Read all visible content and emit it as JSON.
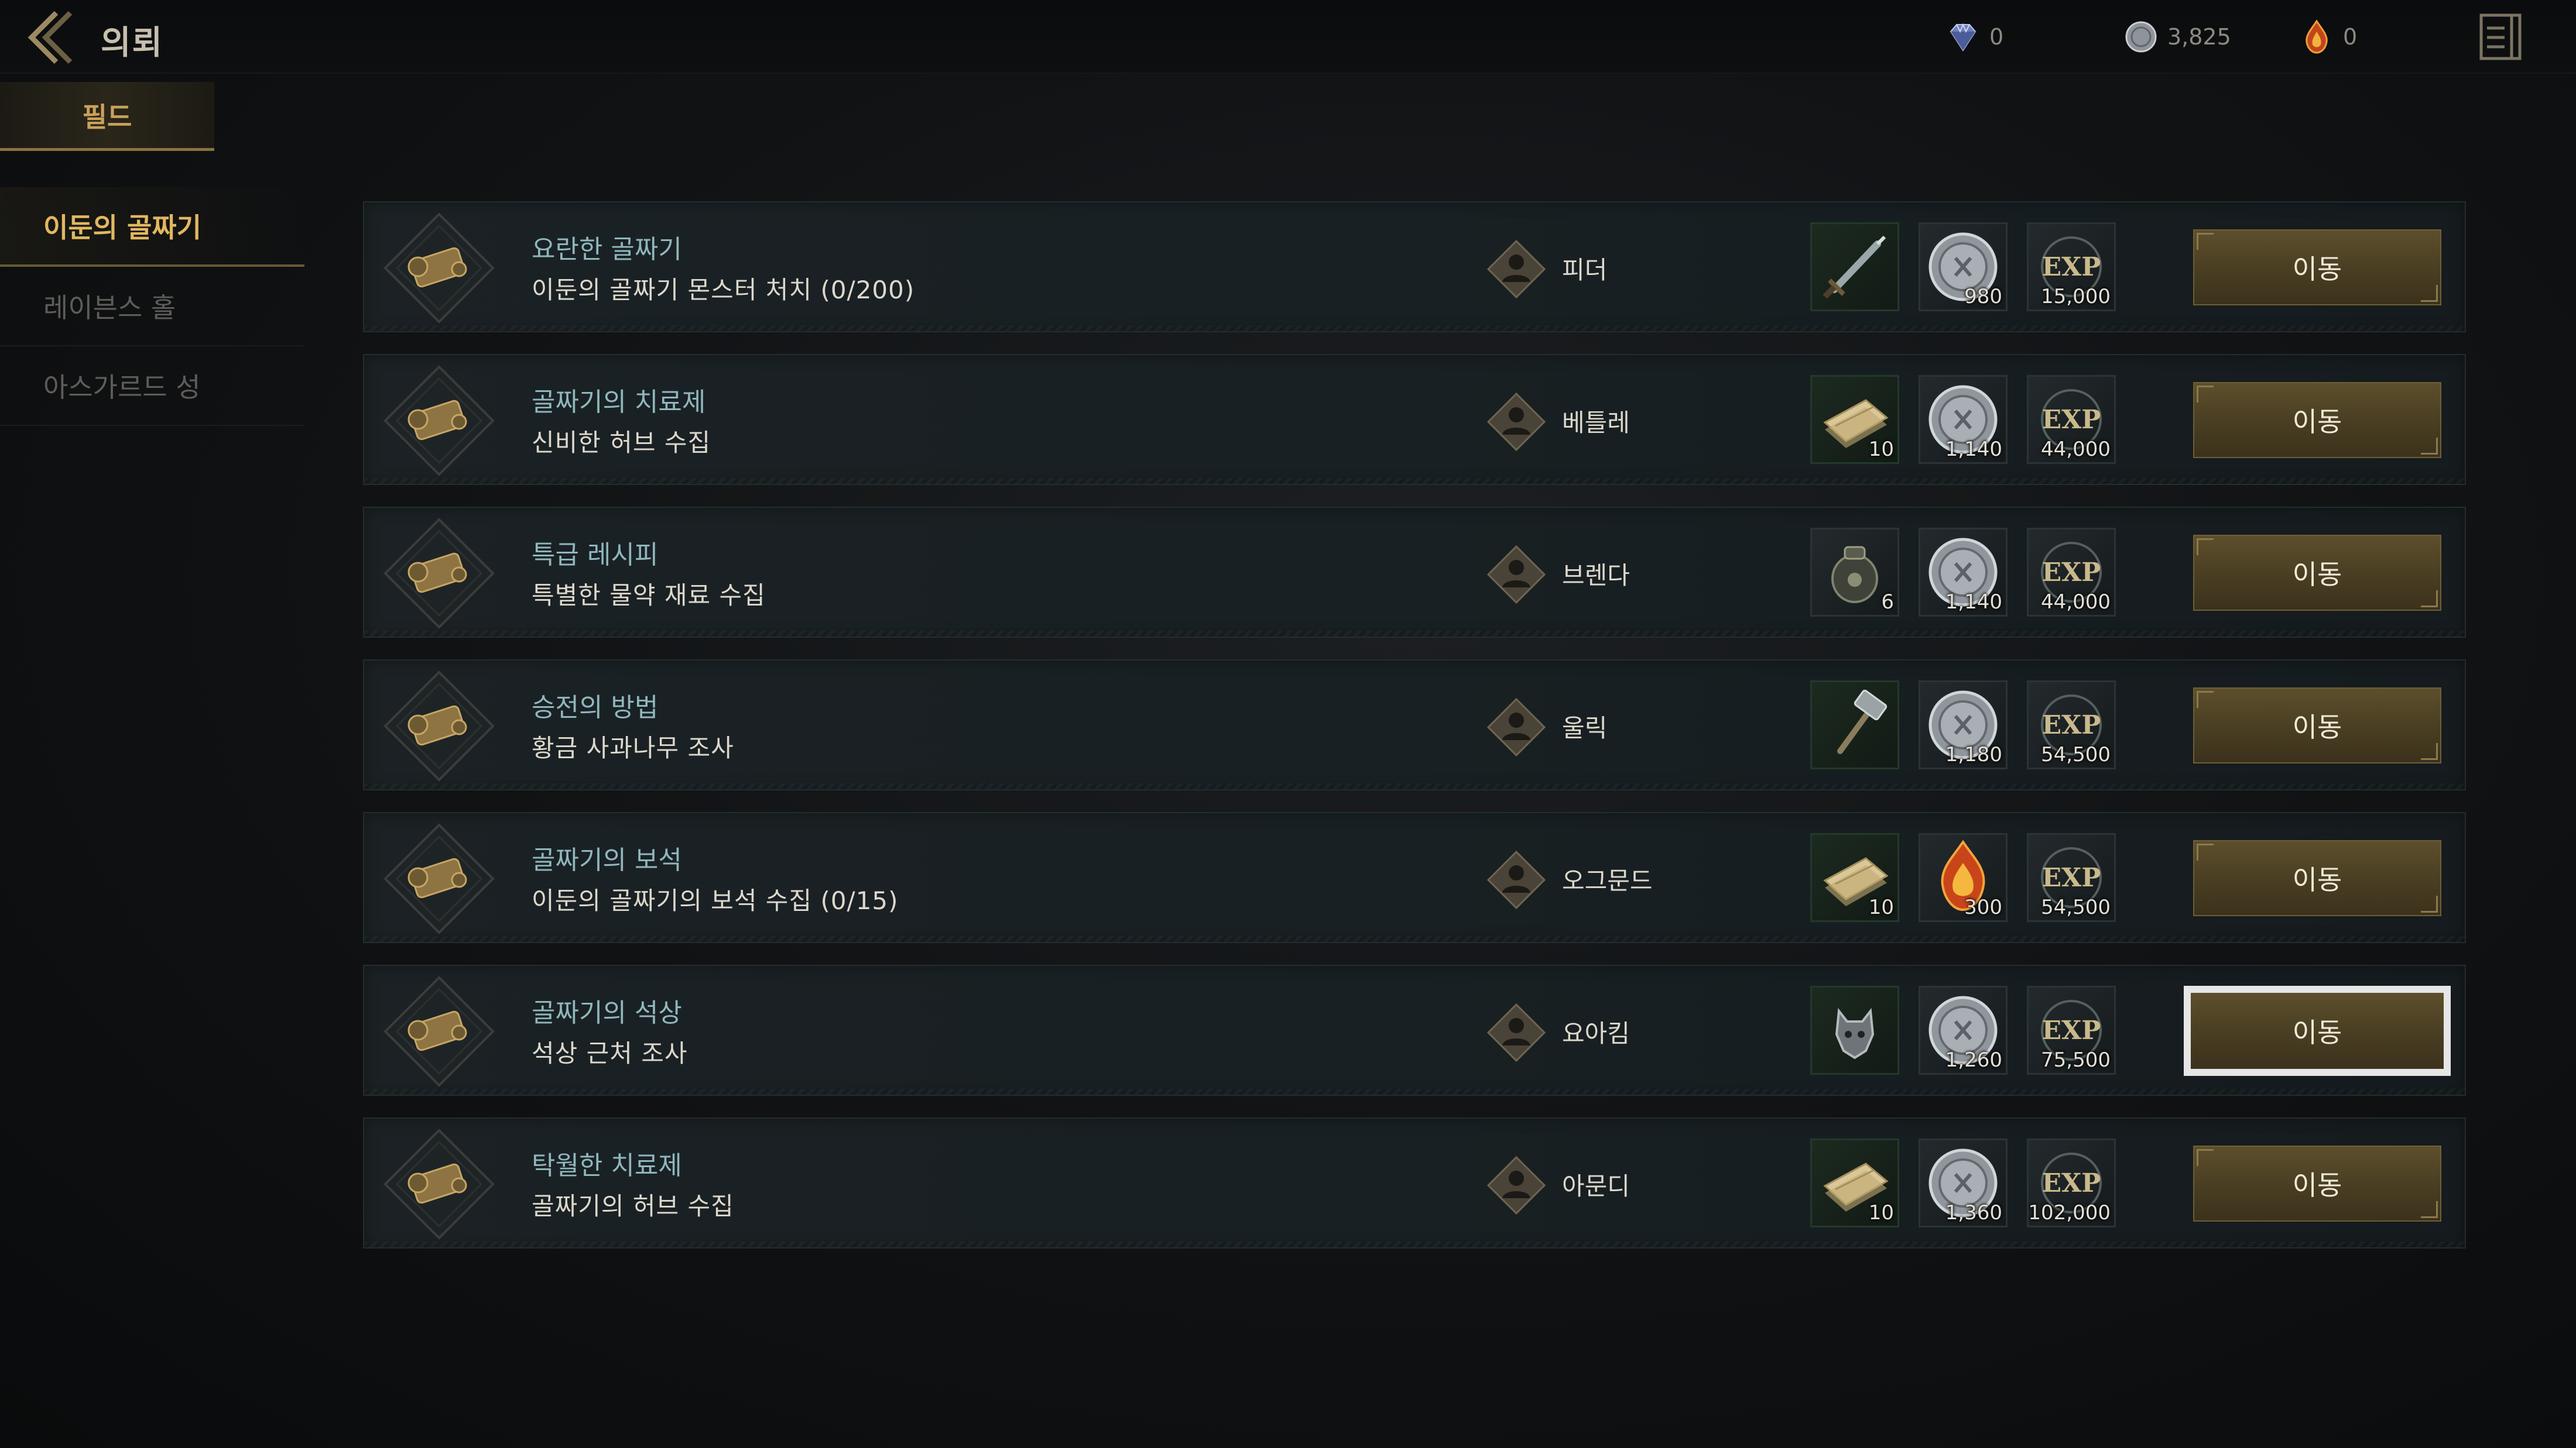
{
  "header": {
    "title": "의뢰",
    "back_icon": "double-chevron-left-icon",
    "menu_icon": "exit-panel-icon",
    "currencies": [
      {
        "name": "diamond-icon",
        "value": "0"
      },
      {
        "name": "silver-coin-icon",
        "value": "3,825"
      },
      {
        "name": "flame-gem-icon",
        "value": "0"
      }
    ]
  },
  "left_panel": {
    "tab_label": "필드",
    "regions": [
      {
        "label": "이둔의 골짜기",
        "active": true
      },
      {
        "label": "레이븐스 홀",
        "active": false
      },
      {
        "label": "아스가르드 성",
        "active": false
      }
    ]
  },
  "quests": [
    {
      "title": "요란한 골짜기",
      "desc": "이둔의 골짜기 몬스터 처치 (0/200)",
      "npc": "피더",
      "rewards": [
        {
          "icon": "sword-icon",
          "count": ""
        },
        {
          "icon": "silver-coin-icon",
          "count": "980"
        },
        {
          "icon": "exp-icon",
          "count": "15,000"
        }
      ],
      "button": "이동"
    },
    {
      "title": "골짜기의 치료제",
      "desc": "신비한 허브 수집",
      "npc": "베틀레",
      "rewards": [
        {
          "icon": "scroll-icon",
          "count": "10"
        },
        {
          "icon": "silver-coin-icon",
          "count": "1,140"
        },
        {
          "icon": "exp-icon",
          "count": "44,000"
        }
      ],
      "button": "이동"
    },
    {
      "title": "특급 레시피",
      "desc": "특별한 물약 재료 수집",
      "npc": "브렌다",
      "rewards": [
        {
          "icon": "pouch-icon",
          "count": "6"
        },
        {
          "icon": "silver-coin-icon",
          "count": "1,140"
        },
        {
          "icon": "exp-icon",
          "count": "44,000"
        }
      ],
      "button": "이동"
    },
    {
      "title": "승전의 방법",
      "desc": "황금 사과나무 조사",
      "npc": "울릭",
      "rewards": [
        {
          "icon": "hammer-icon",
          "count": ""
        },
        {
          "icon": "silver-coin-icon",
          "count": "1,180"
        },
        {
          "icon": "exp-icon",
          "count": "54,500"
        }
      ],
      "button": "이동"
    },
    {
      "title": "골짜기의 보석",
      "desc": "이둔의 골짜기의 보석 수집 (0/15)",
      "npc": "오그문드",
      "rewards": [
        {
          "icon": "scroll-icon",
          "count": "10"
        },
        {
          "icon": "flame-gem-icon",
          "count": "300"
        },
        {
          "icon": "exp-icon",
          "count": "54,500"
        }
      ],
      "button": "이동"
    },
    {
      "title": "골짜기의 석상",
      "desc": "석상 근처 조사",
      "npc": "요아킴",
      "rewards": [
        {
          "icon": "wolf-helm-icon",
          "count": ""
        },
        {
          "icon": "silver-coin-icon",
          "count": "1,260"
        },
        {
          "icon": "exp-icon",
          "count": "75,500"
        }
      ],
      "button": "이동",
      "selected": true
    },
    {
      "title": "탁월한 치료제",
      "desc": "골짜기의 허브 수집",
      "npc": "아문디",
      "rewards": [
        {
          "icon": "scroll-icon",
          "count": "10"
        },
        {
          "icon": "silver-coin-icon",
          "count": "1,360"
        },
        {
          "icon": "exp-icon",
          "count": "102,000"
        }
      ],
      "button": "이동"
    }
  ],
  "colors": {
    "accent_gold": "#e2b761",
    "quest_title": "#8fb7bd",
    "button_bg": "#4a3f23",
    "selected_outline": "#e6e6e6"
  }
}
